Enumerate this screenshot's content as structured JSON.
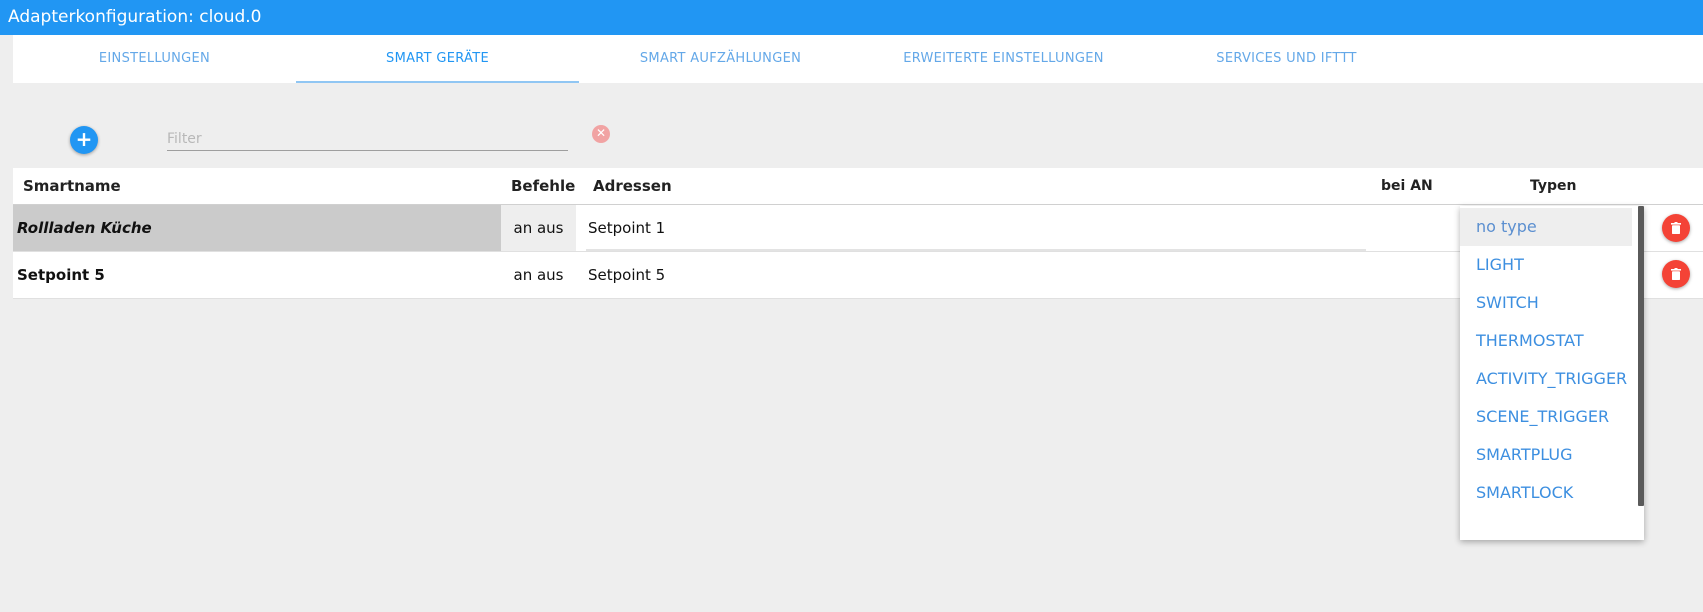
{
  "window": {
    "title": "Adapterkonfiguration: cloud.0"
  },
  "tabs": [
    {
      "label": "EINSTELLUNGEN"
    },
    {
      "label": "SMART GERÄTE"
    },
    {
      "label": "SMART AUFZÄHLUNGEN"
    },
    {
      "label": "ERWEITERTE EINSTELLUNGEN"
    },
    {
      "label": "SERVICES UND IFTTT"
    }
  ],
  "active_tab": "SMART GERÄTE",
  "toolbar": {
    "add_label": "+",
    "filter_placeholder": "Filter",
    "clear_label": "✕"
  },
  "table": {
    "headers": {
      "smartname": "Smartname",
      "befehle": "Befehle",
      "adressen": "Adressen",
      "bei_an": "bei AN",
      "typen": "Typen"
    },
    "rows": [
      {
        "smartname": "Rollladen Küche",
        "befehle": "an aus",
        "adresse": "Setpoint 1"
      },
      {
        "smartname": "Setpoint 5",
        "befehle": "an aus",
        "adresse": "Setpoint 5"
      }
    ]
  },
  "type_dropdown": {
    "selected": "no type",
    "options": [
      "no type",
      "LIGHT",
      "SWITCH",
      "THERMOSTAT",
      "ACTIVITY_TRIGGER",
      "SCENE_TRIGGER",
      "SMARTPLUG",
      "SMARTLOCK"
    ]
  },
  "icons": {
    "add": "plus-icon",
    "clear": "close-icon",
    "delete": "trash-icon"
  },
  "colors": {
    "primary": "#2196f3",
    "danger": "#f44336",
    "clear": "#f1a3a3"
  }
}
